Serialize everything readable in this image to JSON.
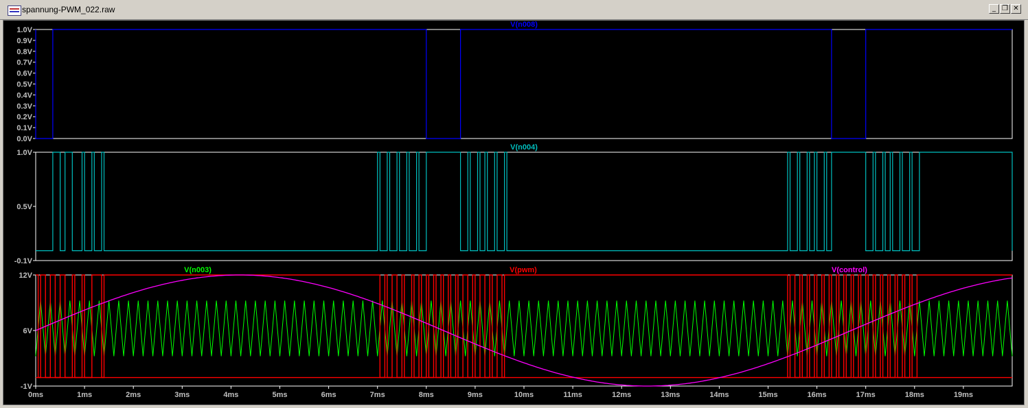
{
  "window": {
    "title": "spannung-PWM_022.raw",
    "minimize_label": "_",
    "restore_label": "❐",
    "close_label": "✕"
  },
  "colors": {
    "n008": "#0000ff",
    "n004": "#00bfbf",
    "n003": "#00ff00",
    "pwm": "#ff0000",
    "control": "#ff00ff",
    "axis_text": "#c0c0c0",
    "frame": "#ffffff",
    "background": "#000000"
  },
  "panes": [
    {
      "traces": [
        {
          "name": "V(n008)",
          "color_key": "n008"
        }
      ],
      "y_ticks": [
        "1.0V",
        "0.9V",
        "0.8V",
        "0.7V",
        "0.6V",
        "0.5V",
        "0.4V",
        "0.3V",
        "0.2V",
        "0.1V",
        "0.0V"
      ],
      "y_range": [
        0,
        1
      ],
      "n008_high_intervals_ms": [
        [
          0,
          0.35
        ],
        [
          8.0,
          8.7
        ],
        [
          16.3,
          17.0
        ]
      ]
    },
    {
      "traces": [
        {
          "name": "V(n004)",
          "color_key": "n004"
        }
      ],
      "y_ticks": [
        "1.0V",
        "0.5V",
        "-0.1V"
      ],
      "y_range": [
        -0.1,
        1.0
      ],
      "n004_high_pulses_ms": [
        [
          0.35,
          0.5
        ],
        [
          0.6,
          0.75
        ],
        [
          0.95,
          1.0
        ],
        [
          1.15,
          1.2
        ],
        [
          1.35,
          1.4
        ],
        [
          7.0,
          7.05
        ],
        [
          7.2,
          7.25
        ],
        [
          7.4,
          7.45
        ],
        [
          7.6,
          7.65
        ],
        [
          7.8,
          7.85
        ],
        [
          8.0,
          8.7
        ],
        [
          8.85,
          8.9
        ],
        [
          9.05,
          9.1
        ],
        [
          9.2,
          9.25
        ],
        [
          9.4,
          9.45
        ],
        [
          9.6,
          9.65
        ],
        [
          15.4,
          15.45
        ],
        [
          15.6,
          15.65
        ],
        [
          15.8,
          15.85
        ],
        [
          15.95,
          16.0
        ],
        [
          16.15,
          16.2
        ],
        [
          16.3,
          17.0
        ],
        [
          17.15,
          17.2
        ],
        [
          17.35,
          17.4
        ],
        [
          17.5,
          17.55
        ],
        [
          17.7,
          17.75
        ],
        [
          17.9,
          17.95
        ],
        [
          18.1,
          20.0
        ]
      ]
    },
    {
      "traces": [
        {
          "name": "V(n003)",
          "color_key": "n003"
        },
        {
          "name": "V(pwm)",
          "color_key": "pwm"
        },
        {
          "name": "V(control)",
          "color_key": "control"
        }
      ],
      "y_ticks": [
        "12V",
        "6V",
        "-1V"
      ],
      "y_range": [
        -1,
        12
      ],
      "pwm_low_level_V": 0,
      "pwm_high_level_V": 12,
      "pwm_pulses_ms": [
        [
          0.05,
          0.1
        ],
        [
          0.2,
          0.3
        ],
        [
          0.4,
          0.5
        ],
        [
          0.6,
          0.75
        ],
        [
          0.8,
          0.95
        ],
        [
          1.0,
          1.15
        ],
        [
          1.35,
          1.4
        ],
        [
          7.05,
          7.15
        ],
        [
          7.2,
          7.3
        ],
        [
          7.4,
          7.5
        ],
        [
          7.55,
          7.7
        ],
        [
          7.75,
          7.85
        ],
        [
          7.9,
          8.0
        ],
        [
          8.05,
          8.15
        ],
        [
          8.2,
          8.3
        ],
        [
          8.35,
          8.45
        ],
        [
          8.5,
          8.6
        ],
        [
          8.65,
          8.75
        ],
        [
          8.85,
          8.95
        ],
        [
          9.0,
          9.1
        ],
        [
          9.2,
          9.3
        ],
        [
          9.35,
          9.45
        ],
        [
          9.55,
          9.6
        ],
        [
          15.4,
          15.45
        ],
        [
          15.55,
          15.65
        ],
        [
          15.7,
          15.8
        ],
        [
          15.85,
          15.95
        ],
        [
          16.0,
          16.1
        ],
        [
          16.15,
          16.25
        ],
        [
          16.3,
          16.4
        ],
        [
          16.45,
          16.55
        ],
        [
          16.6,
          16.7
        ],
        [
          16.75,
          16.85
        ],
        [
          16.9,
          17.0
        ],
        [
          17.05,
          17.15
        ],
        [
          17.2,
          17.3
        ],
        [
          17.35,
          17.45
        ],
        [
          17.5,
          17.6
        ],
        [
          17.65,
          17.75
        ],
        [
          17.8,
          17.9
        ],
        [
          17.95,
          18.05
        ]
      ],
      "control_sine": {
        "offset_V": 5.5,
        "amplitude_V": 6.5,
        "period_ms": 16.7,
        "phase_deg": 0
      },
      "n003_triangle": {
        "min_V": 2.5,
        "max_V": 9.0,
        "period_ms": 0.2
      }
    }
  ],
  "x_axis": {
    "ticks": [
      "0ms",
      "1ms",
      "2ms",
      "3ms",
      "4ms",
      "5ms",
      "6ms",
      "7ms",
      "8ms",
      "9ms",
      "10ms",
      "11ms",
      "12ms",
      "13ms",
      "14ms",
      "15ms",
      "16ms",
      "17ms",
      "18ms",
      "19ms"
    ],
    "range_ms": [
      0,
      20
    ]
  }
}
